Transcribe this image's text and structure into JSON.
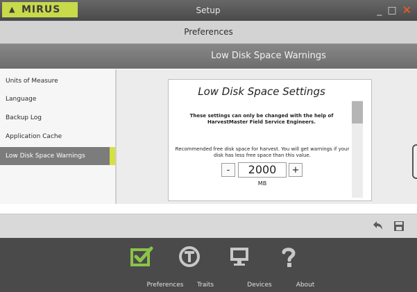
{
  "app": {
    "logo": "MIRUS",
    "window_title": "Setup",
    "controls": {
      "minimize": "_",
      "maximize": "□",
      "close": "✕"
    }
  },
  "header": {
    "title": "Preferences"
  },
  "section": {
    "title": "Low Disk Space Warnings"
  },
  "sidebar": {
    "items": [
      {
        "label": "Units of Measure"
      },
      {
        "label": "Language"
      },
      {
        "label": "Backup Log"
      },
      {
        "label": "Application Cache"
      },
      {
        "label": "Low Disk Space Warnings"
      }
    ],
    "active_index": 4,
    "accent_color": "#d6e03f"
  },
  "card": {
    "title": "Low Disk Space Settings",
    "warning": "These settings can only be changed with the help of HarvestMaster Field Service Engineers.",
    "description": "Recommended free disk space for harvest. You will get warnings if your disk has less free space than this value.",
    "stepper": {
      "minus": "-",
      "value": "2000",
      "plus": "+",
      "unit": "MB"
    }
  },
  "toolbar": {
    "icons": [
      "undo-icon",
      "save-icon"
    ]
  },
  "bottom_nav": [
    {
      "label": "Preferences",
      "icon": "checkbox-icon"
    },
    {
      "label": "Traits",
      "icon": "traits-icon"
    },
    {
      "label": "Devices",
      "icon": "monitor-icon"
    },
    {
      "label": "About",
      "icon": "question-icon"
    }
  ],
  "colors": {
    "brand": "#c8d94a",
    "close_button": "#ff5a1f",
    "active_nav_icon": "#8bc34a"
  }
}
